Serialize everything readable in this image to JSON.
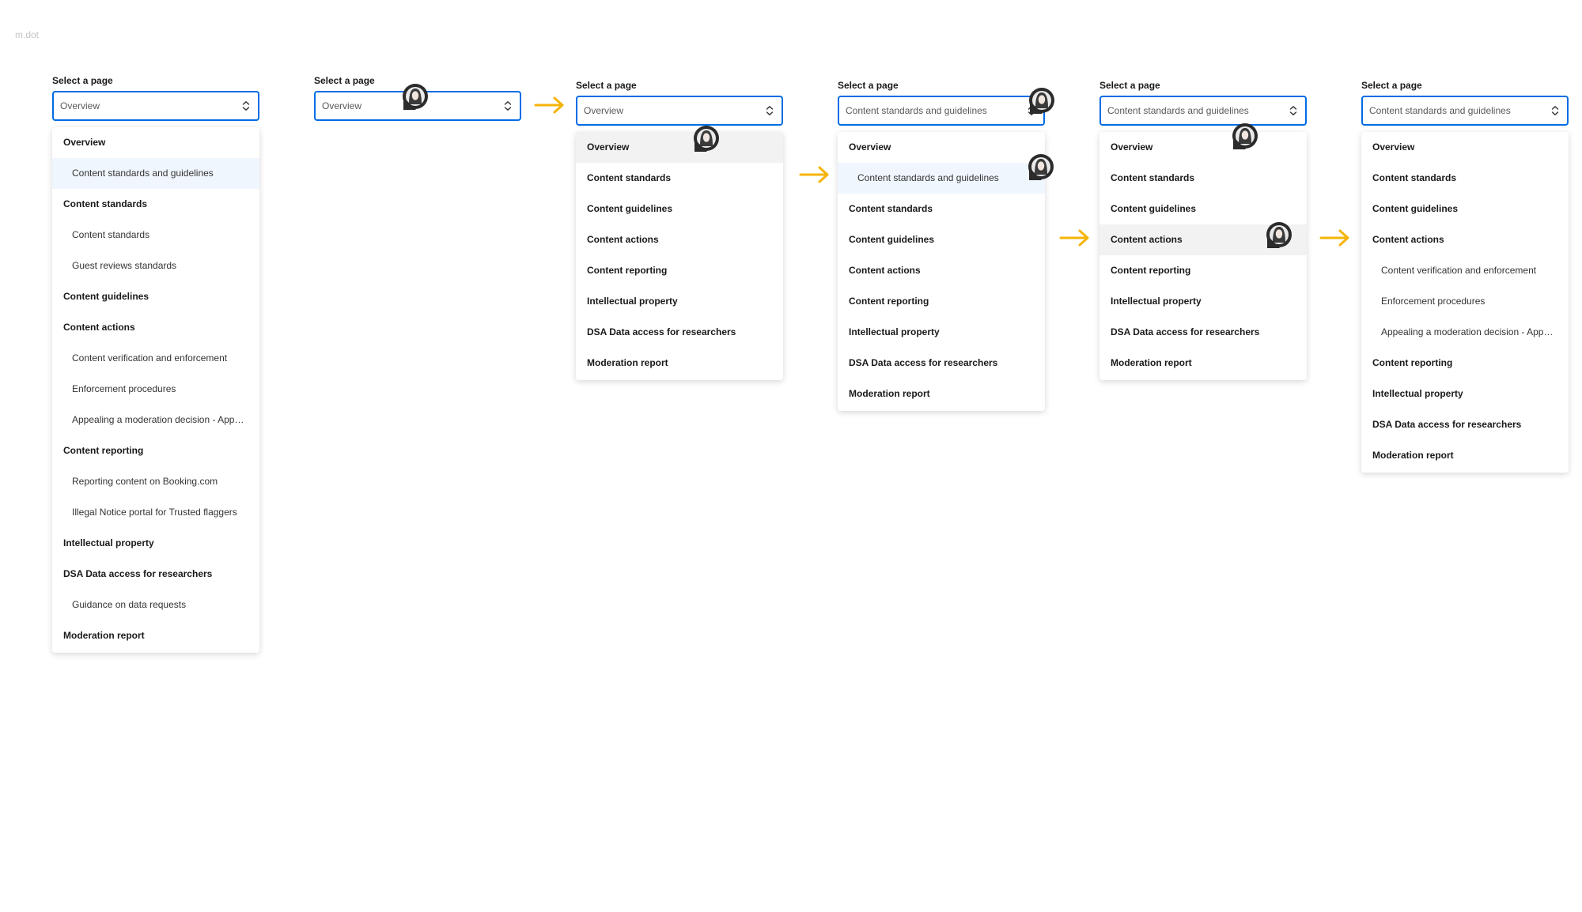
{
  "corner_mark": "m.dot",
  "select_label": "Select a page",
  "frames": [
    {
      "label": "Select a page",
      "value": "Overview",
      "menu": [
        {
          "label": "Overview",
          "level": 1
        },
        {
          "label": "Content standards and guidelines",
          "level": 2,
          "state": "selected"
        },
        {
          "label": "Content standards",
          "level": 1
        },
        {
          "label": "Content standards",
          "level": 2
        },
        {
          "label": "Guest reviews standards",
          "level": 2
        },
        {
          "label": "Content guidelines",
          "level": 1
        },
        {
          "label": "Content actions",
          "level": 1
        },
        {
          "label": "Content verification and enforcement",
          "level": 2
        },
        {
          "label": "Enforcement procedures",
          "level": 2
        },
        {
          "label": "Appealing a moderation decision - Appeals portal",
          "level": 2
        },
        {
          "label": "Content reporting",
          "level": 1
        },
        {
          "label": "Reporting content on Booking.com",
          "level": 2
        },
        {
          "label": "Illegal Notice portal for Trusted flaggers",
          "level": 2
        },
        {
          "label": "Intellectual property",
          "level": 1
        },
        {
          "label": "DSA Data access for researchers",
          "level": 1
        },
        {
          "label": "Guidance on data requests",
          "level": 2
        },
        {
          "label": "Moderation report",
          "level": 1
        }
      ]
    },
    {
      "label": "Select a page",
      "value": "Overview",
      "menu": []
    },
    {
      "label": "Select a page",
      "value": "Overview",
      "menu": [
        {
          "label": "Overview",
          "level": 1,
          "state": "hover"
        },
        {
          "label": "Content standards",
          "level": 1
        },
        {
          "label": "Content guidelines",
          "level": 1
        },
        {
          "label": "Content actions",
          "level": 1
        },
        {
          "label": "Content reporting",
          "level": 1
        },
        {
          "label": "Intellectual property",
          "level": 1
        },
        {
          "label": "DSA Data access for researchers",
          "level": 1
        },
        {
          "label": "Moderation report",
          "level": 1
        }
      ]
    },
    {
      "label": "Select a page",
      "value": "Content standards and guidelines",
      "menu": [
        {
          "label": "Overview",
          "level": 1
        },
        {
          "label": "Content standards and guidelines",
          "level": 2,
          "state": "selected"
        },
        {
          "label": "Content standards",
          "level": 1
        },
        {
          "label": "Content guidelines",
          "level": 1
        },
        {
          "label": "Content actions",
          "level": 1
        },
        {
          "label": "Content reporting",
          "level": 1
        },
        {
          "label": "Intellectual property",
          "level": 1
        },
        {
          "label": "DSA Data access for researchers",
          "level": 1
        },
        {
          "label": "Moderation report",
          "level": 1
        }
      ]
    },
    {
      "label": "Select a page",
      "value": "Content standards and guidelines",
      "menu": [
        {
          "label": "Overview",
          "level": 1
        },
        {
          "label": "Content standards",
          "level": 1
        },
        {
          "label": "Content guidelines",
          "level": 1
        },
        {
          "label": "Content actions",
          "level": 1,
          "state": "hover"
        },
        {
          "label": "Content reporting",
          "level": 1
        },
        {
          "label": "Intellectual property",
          "level": 1
        },
        {
          "label": "DSA Data access for researchers",
          "level": 1
        },
        {
          "label": "Moderation report",
          "level": 1
        }
      ]
    },
    {
      "label": "Select a page",
      "value": "Content standards and guidelines",
      "menu": [
        {
          "label": "Overview",
          "level": 1
        },
        {
          "label": "Content standards",
          "level": 1
        },
        {
          "label": "Content guidelines",
          "level": 1
        },
        {
          "label": "Content actions",
          "level": 1
        },
        {
          "label": "Content verification and enforcement",
          "level": 2
        },
        {
          "label": "Enforcement procedures",
          "level": 2
        },
        {
          "label": "Appealing a moderation decision - Appeals portal",
          "level": 2
        },
        {
          "label": "Content reporting",
          "level": 1
        },
        {
          "label": "Intellectual property",
          "level": 1
        },
        {
          "label": "DSA Data access for researchers",
          "level": 1
        },
        {
          "label": "Moderation report",
          "level": 1
        }
      ]
    }
  ],
  "icons": {
    "select_toggle": "chevron-up-down-icon",
    "step_arrow": "arrow-right-icon",
    "cursor": "user-avatar-cursor-icon"
  },
  "colors": {
    "accent": "#006ce4",
    "step_arrow": "#f5b40a",
    "selected_bg": "#f0f6fd",
    "hover_bg": "#f2f2f2"
  }
}
